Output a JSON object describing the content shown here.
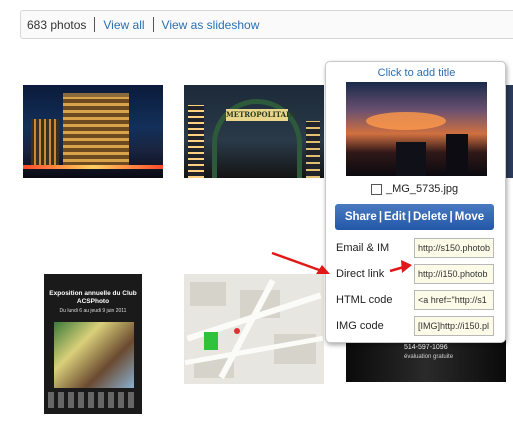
{
  "header": {
    "count_label": "683 photos",
    "view_all": "View all",
    "view_slideshow": "View as slideshow"
  },
  "thumbnails": {
    "metro_sign": "METROPOLITAIN",
    "poster_title": "Exposition annuelle du Club ACSPhoto",
    "poster_subtitle": "Du lundi 6 au jeudi 9 juin 2011",
    "partial_phone": "514-597-1096",
    "partial_text": "évaluation gratuite"
  },
  "popup": {
    "title_prompt": "Click to add title",
    "filename": "_MG_5735.jpg",
    "actions": [
      "Share",
      "Edit",
      "Delete",
      "Move"
    ],
    "rows": [
      {
        "label": "Email & IM",
        "value": "http://s150.photob"
      },
      {
        "label": "Direct link",
        "value": "http://i150.photob"
      },
      {
        "label": "HTML code",
        "value": "<a href=\"http://s1"
      },
      {
        "label": "IMG code",
        "value": "[IMG]http://i150.pl"
      }
    ]
  },
  "colors": {
    "link": "#2a6fb0",
    "action_bar": "#2358a8",
    "annotation_arrow": "#e01818"
  }
}
